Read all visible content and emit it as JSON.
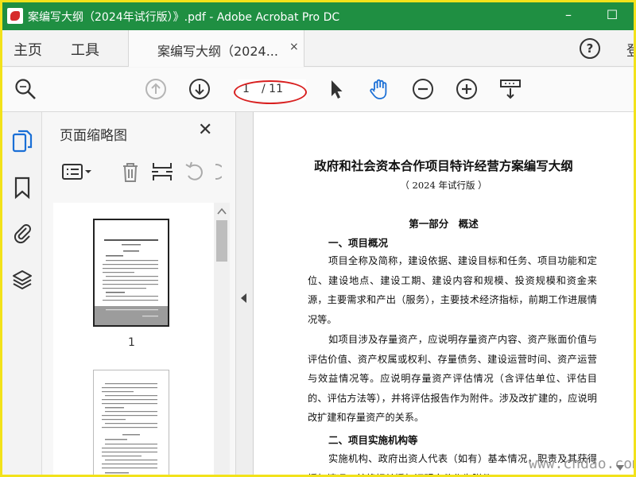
{
  "window": {
    "title": "案编写大纲（2024年试行版）》.pdf - Adobe Acrobat Pro DC",
    "minimize": "–",
    "maximize": "☐"
  },
  "tabs": {
    "home": "主页",
    "tools": "工具",
    "document": "案编写大纲（2024...",
    "close": "×",
    "help": "?",
    "signin": "登"
  },
  "toolbar": {
    "page_current": "1",
    "page_total": "/ 11"
  },
  "thumbnails": {
    "title": "页面缩略图",
    "close": "✕",
    "page1_label": "1"
  },
  "document": {
    "title": "政府和社会资本合作项目特许经营方案编写大纲",
    "subtitle": "（ 2024 年试行版 ）",
    "part": "第一部分　概述",
    "section1": "一、项目概况",
    "para1": "项目全称及简称，建设依据、建设目标和任务、项目功能和定位、建设地点、建设工期、建设内容和规模、投资规模和资金来源，主要需求和产出（服务），主要技术经济指标，前期工作进展情况等。",
    "para2": "如项目涉及存量资产，应说明存量资产内容、资产账面价值与评估价值、资产权属或权利、存量债务、建设运营时间、资产运营与效益情况等。应说明存量资产评估情况（含评估单位、评估目的、评估方法等），并将评估报告作为附件。涉及改扩建的，应说明改扩建和存量资产的关系。",
    "section2": "二、项目实施机构等",
    "para3": "实施机构、政府出资人代表（如有）基本情况，职责及其获得授权情况，并将相关授权证明文件作为附件。"
  },
  "watermark": "www.cndao.com",
  "colors": {
    "titlebar": "#1f8f42",
    "highlight_circle": "#d81f1f",
    "hand_tool": "#1a6fd6"
  }
}
